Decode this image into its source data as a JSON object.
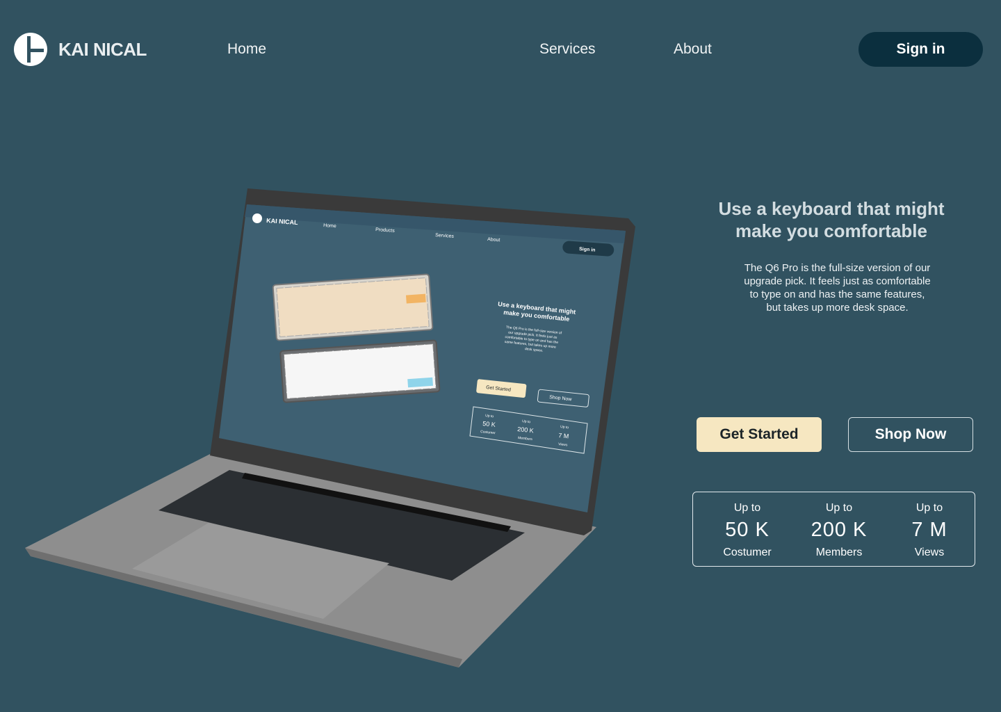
{
  "brand": {
    "name": "KAI NICAL",
    "icon": "logo-mark-icon"
  },
  "nav": {
    "home": "Home",
    "services": "Services",
    "about": "About",
    "sign_in": "Sign in"
  },
  "hero": {
    "title": "Use a keyboard that might make you comfortable",
    "description": "The Q6 Pro is the full-size version of our upgrade pick. It feels just as comfortable to type on and has the same features, but takes up more desk space.",
    "primary_button": "Get Started",
    "secondary_button": "Shop Now"
  },
  "stats": [
    {
      "prefix": "Up to",
      "value": "50  K",
      "label": "Costumer"
    },
    {
      "prefix": "Up to",
      "value": "200  K",
      "label": "Members"
    },
    {
      "prefix": "Up to",
      "value": "7  M",
      "label": "Views"
    }
  ],
  "mockup": {
    "brand": "KAI NICAL",
    "nav": [
      "Home",
      "Products",
      "Services",
      "About"
    ],
    "sign_in": "Sign in",
    "title_line1": "Use a keyboard that might",
    "title_line2": "make you comfortable",
    "desc_lines": [
      "The Q6 Pro is the full-size version of",
      "our upgrade pick. It feels just as",
      "comfortable to type on and has the",
      "same features, but takes up more",
      "desk space."
    ],
    "primary_button": "Get Started",
    "secondary_button": "Shop Now",
    "stats": [
      {
        "prefix": "Up to",
        "value": "50  K",
        "label": "Costumer"
      },
      {
        "prefix": "Up to",
        "value": "200  K",
        "label": "Members"
      },
      {
        "prefix": "Up to",
        "value": "7  M",
        "label": "Views"
      }
    ]
  },
  "colors": {
    "background": "#315260",
    "sign_in_bg": "#0b2f3e",
    "primary_button_bg": "#f6e7c1",
    "laptop_body": "#8a8a8a",
    "screen_bg": "#3e6072"
  }
}
